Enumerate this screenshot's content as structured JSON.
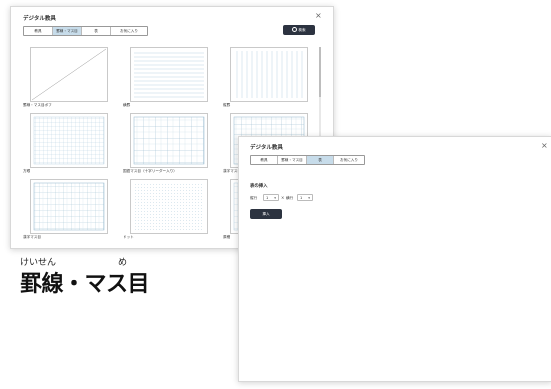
{
  "window1": {
    "title": "デジタル教具",
    "close": "×",
    "tabs": [
      {
        "label": "教具",
        "active": false
      },
      {
        "label": "罫線・マス目",
        "active": true
      },
      {
        "label": "表",
        "active": false
      },
      {
        "label": "お気に入り",
        "active": false
      }
    ],
    "search_label": "検索",
    "templates": [
      {
        "label": "罫線・マス目ボフ",
        "kind": "diagonal"
      },
      {
        "label": "横罫",
        "kind": "hlines"
      },
      {
        "label": "縦罫",
        "kind": "vlines"
      },
      {
        "label": "方眼",
        "kind": "grid-small"
      },
      {
        "label": "国語マス目（十字リーダー入り）",
        "kind": "cross-grid"
      },
      {
        "label": "漢字マス目（十字リーダー入り）",
        "kind": "grid-cross-partial"
      },
      {
        "label": "漢字マス目",
        "kind": "vcolumns"
      },
      {
        "label": "ドット",
        "kind": "dots"
      },
      {
        "label": "原稿",
        "kind": "partial"
      }
    ]
  },
  "window2": {
    "title": "デジタル教具",
    "close": "×",
    "tabs": [
      {
        "label": "教具",
        "active": false
      },
      {
        "label": "罫線・マス目",
        "active": false
      },
      {
        "label": "表",
        "active": true
      },
      {
        "label": "お気に入り",
        "active": false
      }
    ],
    "section_title": "表の挿入",
    "rows_label": "縦行",
    "rows_value": "1",
    "times": "×",
    "cols_label": "横行",
    "cols_value": "1",
    "insert_label": "挿入"
  },
  "caption": {
    "ruby_left": "けいせん",
    "ruby_right": "め",
    "text": "罫線・マス目"
  },
  "colors": {
    "tab_active": "#c7dcea",
    "button_dark": "#2c3340",
    "grid_line": "#a8c8da"
  }
}
